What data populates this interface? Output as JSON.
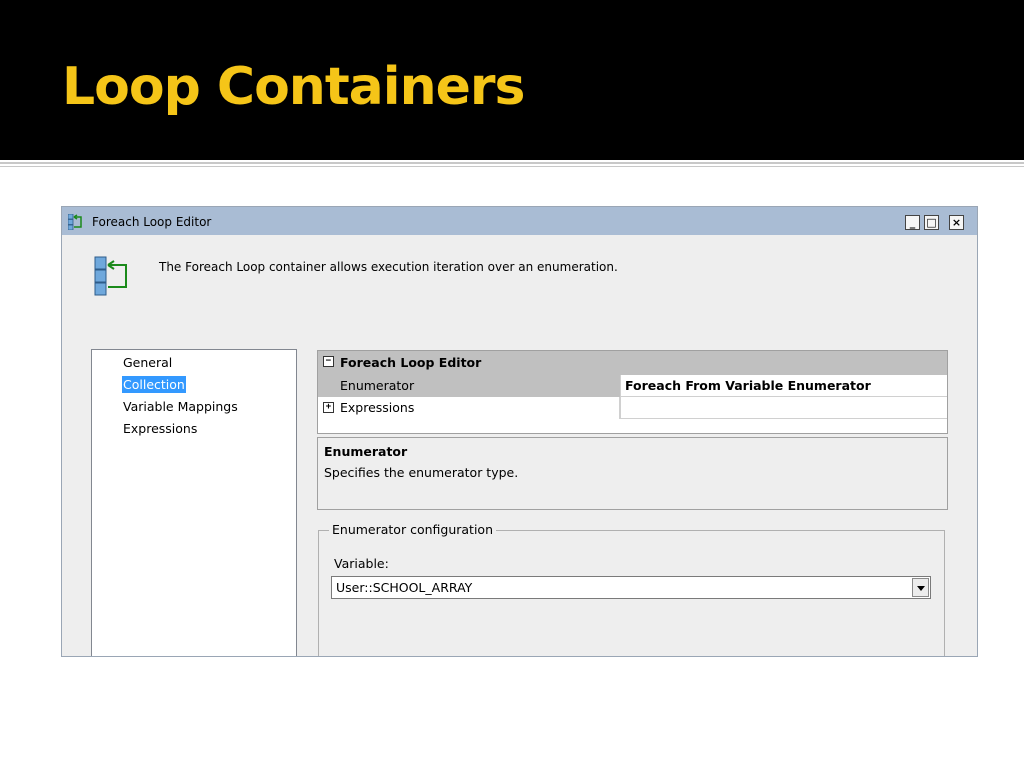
{
  "slide": {
    "title": "Loop Containers"
  },
  "window": {
    "title": "Foreach Loop Editor",
    "controls": {
      "minimize": "_",
      "maximize": "□",
      "close": "×"
    },
    "intro_text": "The Foreach Loop container allows execution iteration over an enumeration.",
    "icon": "foreach-loop-icon"
  },
  "nav": {
    "items": [
      {
        "label": "General"
      },
      {
        "label": "Collection"
      },
      {
        "label": "Variable Mappings"
      },
      {
        "label": "Expressions"
      }
    ],
    "selected": "Collection"
  },
  "property_grid": {
    "header": "Foreach Loop Editor",
    "collapse_icon": "⊟",
    "expand_icon": "⊞",
    "rows": [
      {
        "name": "Enumerator",
        "value": "Foreach From Variable Enumerator"
      },
      {
        "name": "Expressions",
        "value": ""
      }
    ]
  },
  "description": {
    "title": "Enumerator",
    "text": "Specifies the enumerator type."
  },
  "enumerator_config": {
    "legend": "Enumerator configuration",
    "variable_label": "Variable:",
    "variable_value": "User::SCHOOL_ARRAY"
  },
  "colors": {
    "title_text": "#f5c518",
    "titlebar": "#a9bcd4",
    "selection": "#3399ff"
  }
}
